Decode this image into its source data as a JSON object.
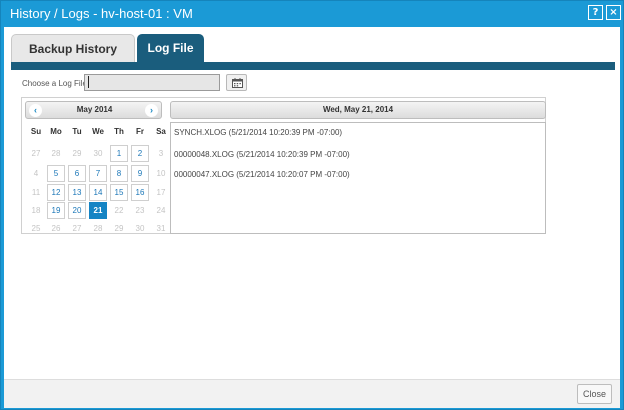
{
  "window": {
    "title": "History / Logs - hv-host-01 : VM",
    "help_label": "?",
    "close_label": "×"
  },
  "tabs": [
    {
      "label": "Backup History",
      "active": false
    },
    {
      "label": "Log File",
      "active": true
    }
  ],
  "log_picker": {
    "label": "Choose a Log File",
    "value": "",
    "calendar_icon": "calendar-icon"
  },
  "calendar": {
    "month_label": "May 2014",
    "prev_label": "‹",
    "next_label": "›",
    "weekdays": [
      "Su",
      "Mo",
      "Tu",
      "We",
      "Th",
      "Fr",
      "Sa"
    ],
    "weeks": [
      [
        {
          "d": "27",
          "t": "other"
        },
        {
          "d": "28",
          "t": "other"
        },
        {
          "d": "29",
          "t": "other"
        },
        {
          "d": "30",
          "t": "other"
        },
        {
          "d": "1",
          "t": "cur"
        },
        {
          "d": "2",
          "t": "cur"
        },
        {
          "d": "3",
          "t": "other"
        }
      ],
      [
        {
          "d": "4",
          "t": "other"
        },
        {
          "d": "5",
          "t": "cur"
        },
        {
          "d": "6",
          "t": "cur"
        },
        {
          "d": "7",
          "t": "cur"
        },
        {
          "d": "8",
          "t": "cur"
        },
        {
          "d": "9",
          "t": "cur"
        },
        {
          "d": "10",
          "t": "other"
        }
      ],
      [
        {
          "d": "11",
          "t": "other"
        },
        {
          "d": "12",
          "t": "cur"
        },
        {
          "d": "13",
          "t": "cur"
        },
        {
          "d": "14",
          "t": "cur"
        },
        {
          "d": "15",
          "t": "cur"
        },
        {
          "d": "16",
          "t": "cur"
        },
        {
          "d": "17",
          "t": "other"
        }
      ],
      [
        {
          "d": "18",
          "t": "other"
        },
        {
          "d": "19",
          "t": "cur"
        },
        {
          "d": "20",
          "t": "cur"
        },
        {
          "d": "21",
          "t": "sel"
        },
        {
          "d": "22",
          "t": "other"
        },
        {
          "d": "23",
          "t": "other"
        },
        {
          "d": "24",
          "t": "other"
        }
      ],
      [
        {
          "d": "25",
          "t": "other"
        },
        {
          "d": "26",
          "t": "other"
        },
        {
          "d": "27",
          "t": "other"
        },
        {
          "d": "28",
          "t": "other"
        },
        {
          "d": "29",
          "t": "other"
        },
        {
          "d": "30",
          "t": "other"
        },
        {
          "d": "31",
          "t": "other"
        }
      ]
    ]
  },
  "log_panel": {
    "date_header": "Wed, May 21, 2014",
    "files": [
      "SYNCH.XLOG (5/21/2014 10:20:39 PM -07:00)",
      "00000048.XLOG (5/21/2014 10:20:39 PM -07:00)",
      "00000047.XLOG (5/21/2014 10:20:07 PM -07:00)"
    ]
  },
  "footer": {
    "close_label": "Close"
  },
  "colors": {
    "titlebar": "#1b9ad6",
    "tab_active": "#1a5d7d",
    "selected_day": "#1584c4"
  }
}
